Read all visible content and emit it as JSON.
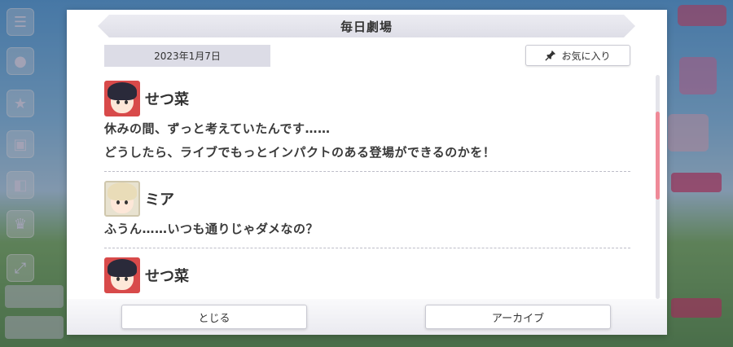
{
  "modal": {
    "title": "毎日劇場",
    "date": "2023年1月7日",
    "favorite_label": "お気に入り",
    "close_label": "とじる",
    "archive_label": "アーカイブ"
  },
  "dialogue": [
    {
      "speaker": "せつ菜",
      "avatar": "setsuna",
      "lines": [
        "休みの間、ずっと考えていたんです……",
        "どうしたら、ライブでもっとインパクトのある登場ができるのかを！"
      ]
    },
    {
      "speaker": "ミア",
      "avatar": "mia",
      "lines": [
        "ふうん……いつも通りじゃダメなの？"
      ]
    },
    {
      "speaker": "せつ菜",
      "avatar": "setsuna",
      "lines": []
    }
  ],
  "icons": {
    "favorite": "pin-icon",
    "menu": "hamburger-menu-icon"
  },
  "colors": {
    "scroll_thumb": "#ef8a98",
    "avatar_setsuna": "#d84a4a",
    "avatar_mia": "#e8e2d0"
  }
}
